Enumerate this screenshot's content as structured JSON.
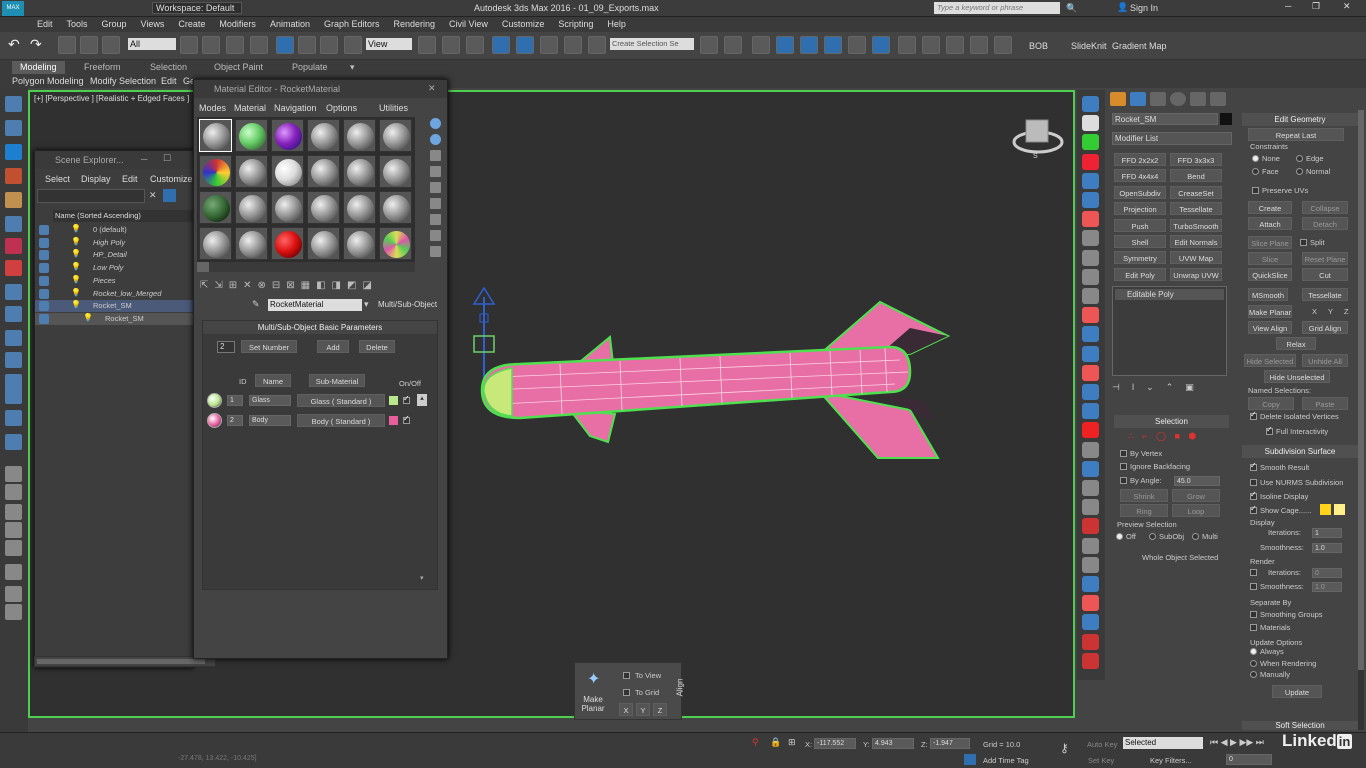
{
  "titlebar": {
    "workspace": "Workspace: Default",
    "title": "Autodesk 3ds Max 2016 - 01_09_Exports.max",
    "search_placeholder": "Type a keyword or phrase",
    "sign_in": "Sign In"
  },
  "menubar": {
    "items": [
      "Edit",
      "Tools",
      "Group",
      "Views",
      "Create",
      "Modifiers",
      "Animation",
      "Graph Editors",
      "Rendering",
      "Civil View",
      "Customize",
      "Scripting",
      "Help"
    ]
  },
  "toolbar": {
    "filter": "All",
    "view": "View",
    "selection_set": "Create Selection Se",
    "labels": [
      "BOB",
      "SlideKnit",
      "Gradient Map"
    ]
  },
  "ribbon": {
    "tabs": [
      "Modeling",
      "Freeform",
      "Selection",
      "Object Paint",
      "Populate"
    ],
    "sub": [
      "Polygon Modeling",
      "Modify Selection",
      "Edit",
      "Ge"
    ]
  },
  "viewport": {
    "label": "[+] [Perspective ] [Realistic + Edged Faces ]"
  },
  "material_editor": {
    "title": "Material Editor - RocketMaterial",
    "menus": [
      "Modes",
      "Material",
      "Navigation",
      "Options",
      "Utilities"
    ],
    "material_name": "RocketMaterial",
    "material_type": "Multi/Sub-Object",
    "rollout_title": "Multi/Sub-Object Basic Parameters",
    "count": "2",
    "set_number": "Set Number",
    "add": "Add",
    "delete": "Delete",
    "col_id": "ID",
    "col_name": "Name",
    "col_sub": "Sub-Material",
    "col_onoff": "On/Off",
    "rows": [
      {
        "id": "1",
        "name": "Glass",
        "sub": "Glass  ( Standard )",
        "color": "#b8e88a"
      },
      {
        "id": "2",
        "name": "Body",
        "sub": "Body  ( Standard )",
        "color": "#e85d9e"
      }
    ]
  },
  "scene_explorer": {
    "title": "Scene Explorer...",
    "menus": [
      "Select",
      "Display",
      "Edit",
      "Customize"
    ],
    "header": "Name (Sorted Ascending)",
    "items": [
      "0 (default)",
      "High Poly",
      "HP_Detail",
      "Low Poly",
      "Pieces",
      "Rocket_low_Merged",
      "Rocket_SM",
      "Rocket_SM"
    ]
  },
  "command_panel": {
    "object_name": "Rocket_SM",
    "modifier_list": "Modifier List",
    "modifiers": [
      "FFD 2x2x2",
      "FFD 3x3x3",
      "FFD 4x4x4",
      "Bend",
      "OpenSubdiv",
      "CreaseSet",
      "Projection",
      "Tessellate",
      "Push",
      "TurboSmooth",
      "Shell",
      "Edit Normals",
      "Symmetry",
      "UVW Map",
      "Edit Poly",
      "Unwrap UVW"
    ],
    "stack_item": "Editable Poly",
    "selection_head": "Selection",
    "by_vertex": "By Vertex",
    "ignore_backfacing": "Ignore Backfacing",
    "by_angle": "By Angle:",
    "angle_value": "45.0",
    "shrink": "Shrink",
    "grow": "Grow",
    "ring": "Ring",
    "loop": "Loop",
    "preview_selection": "Preview Selection",
    "preview_opts": [
      "Off",
      "SubObj",
      "Multi"
    ],
    "whole_object": "Whole Object Selected"
  },
  "edit_geometry": {
    "head": "Edit Geometry",
    "repeat_last": "Repeat Last",
    "constraints": "Constraints",
    "constraint_opts": [
      "None",
      "Edge",
      "Face",
      "Normal"
    ],
    "preserve_uvs": "Preserve UVs",
    "create": "Create",
    "collapse": "Collapse",
    "attach": "Attach",
    "detach": "Detach",
    "slice_plane": "Slice Plane",
    "split": "Split",
    "slice": "Slice",
    "reset_plane": "Reset Plane",
    "quickslice": "QuickSlice",
    "cut": "Cut",
    "msmooth": "MSmooth",
    "tessellate": "Tessellate",
    "make_planar": "Make Planar",
    "xyz": [
      "X",
      "Y",
      "Z"
    ],
    "view_align": "View Align",
    "grid_align": "Grid Align",
    "relax": "Relax",
    "hide_selected": "Hide Selected",
    "unhide_all": "Unhide All",
    "hide_unselected": "Hide Unselected",
    "named_selections": "Named Selections:",
    "copy": "Copy",
    "paste": "Paste",
    "delete_isolated": "Delete Isolated Vertices",
    "full_interactivity": "Full Interactivity"
  },
  "subdivision": {
    "head": "Subdivision Surface",
    "smooth_result": "Smooth Result",
    "use_nurms": "Use NURMS Subdivision",
    "isoline": "Isoline Display",
    "show_cage": "Show Cage......",
    "display": "Display",
    "iterations": "Iterations:",
    "iter_val": "1",
    "smoothness": "Smoothness:",
    "smooth_val": "1.0",
    "render": "Render",
    "r_iter_val": "0",
    "r_smooth_val": "1.0",
    "separate_by": "Separate By",
    "smoothing_groups": "Smoothing Groups",
    "materials": "Materials",
    "update_options": "Update Options",
    "always": "Always",
    "when_rendering": "When Rendering",
    "manually": "Manually",
    "update": "Update",
    "soft_selection": "Soft Selection"
  },
  "align_popup": {
    "make_planar": "Make\nPlanar",
    "to_view": "To View",
    "to_grid": "To Grid",
    "align": "Align",
    "xyz": [
      "X",
      "Y",
      "Z"
    ]
  },
  "status": {
    "x_label": "X:",
    "x": "-117.552",
    "y_label": "Y:",
    "y": "4.943",
    "z_label": "Z:",
    "z": "-1.947",
    "grid": "Grid = 10.0",
    "add_time_tag": "Add Time Tag",
    "auto_key": "Auto Key",
    "selected": "Selected",
    "set_key": "Set Key",
    "key_filters": "Key Filters...",
    "frame": "0",
    "coords_small": "-27.478, 13.422, -10.425]"
  },
  "colors": {
    "viewport_border": "#4fcf4f",
    "rocket": "#e86fa6",
    "accent_blue": "#2f6fb0"
  }
}
